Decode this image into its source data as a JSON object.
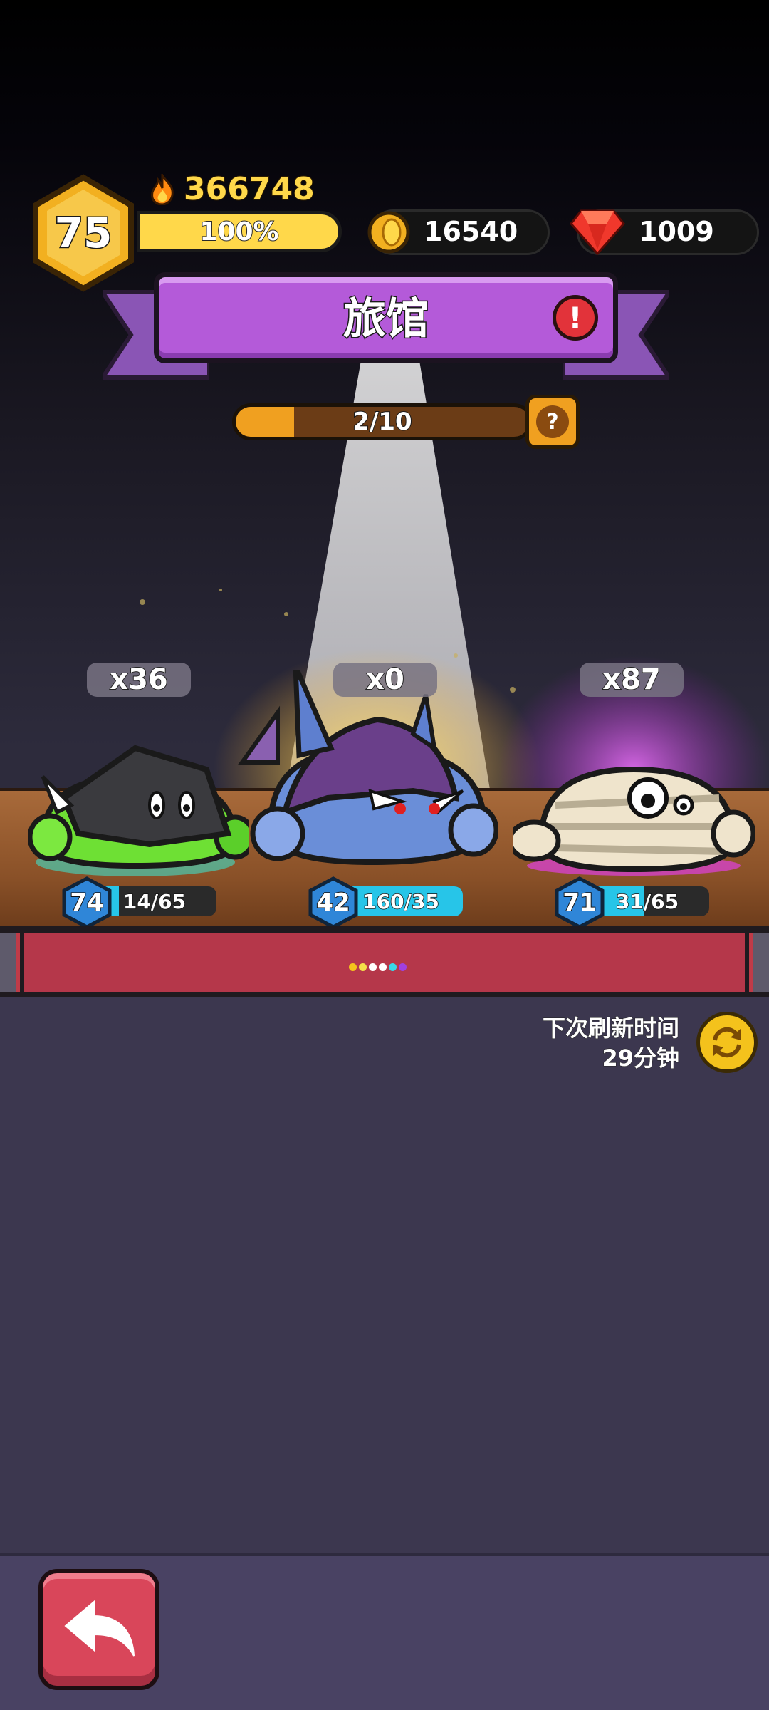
{
  "header": {
    "player_level": "75",
    "power": "366748",
    "xp_percent_label": "100%",
    "xp_fill": 1.0,
    "coins": "16540",
    "gems": "1009"
  },
  "title": {
    "label": "旅馆",
    "alert_icon": "exclamation-icon"
  },
  "progress": {
    "label": "2/10",
    "fraction": 0.2,
    "help_label": "?"
  },
  "monsters": [
    {
      "name": "green-slime-monster",
      "count": "x36",
      "level": "74",
      "stat": "14/65",
      "fill": 0.215,
      "glow": "#3fe0c8"
    },
    {
      "name": "blue-knight-slime-monster",
      "count": "x0",
      "level": "42",
      "stat": "160/35",
      "fill": 1.0,
      "glow": "#ffd640"
    },
    {
      "name": "mummy-slime-monster",
      "count": "x87",
      "level": "71",
      "stat": "31/65",
      "fill": 0.477,
      "glow": "#e040e0"
    }
  ],
  "carousel_dot_colors": [
    "#f4c21c",
    "#f4e04a",
    "#ffffff",
    "#ffffff",
    "#38d8e8",
    "#a040e0"
  ],
  "refresh": {
    "line1": "下次刷新时间",
    "line2": "29分钟",
    "icon": "refresh-icon"
  },
  "back": {
    "icon": "back-arrow-icon"
  },
  "colors": {
    "banner": "#b45ad9",
    "accent_gold": "#ffd84a",
    "rail_red": "#bf3b48"
  }
}
